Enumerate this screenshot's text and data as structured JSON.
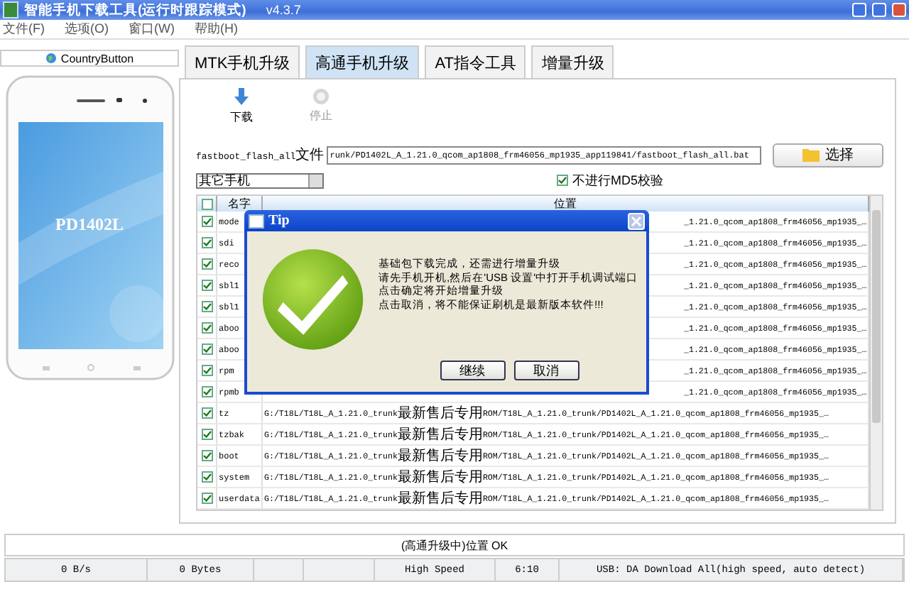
{
  "window": {
    "title": "智能手机下载工具(运行时跟踪模式)",
    "version": "v4.3.7"
  },
  "menu": [
    "文件(F)",
    "选项(O)",
    "窗口(W)",
    "帮助(H)"
  ],
  "sidebar": {
    "country_button": "CountryButton",
    "phone_label": "PD1402L"
  },
  "tabs": [
    {
      "label": "MTK手机升级",
      "selected": false
    },
    {
      "label": "高通手机升级",
      "selected": true
    },
    {
      "label": "AT指令工具",
      "selected": false
    },
    {
      "label": "增量升级",
      "selected": false
    }
  ],
  "toolbar": [
    {
      "label": "下载",
      "disabled": false
    },
    {
      "label": "停止",
      "disabled": true
    }
  ],
  "file_row": {
    "label": "fastboot_flash_all文件",
    "value": "runk/PD1402L_A_1.21.0_qcom_ap1808_frm46056_mp1935_app119841/fastboot_flash_all.bat",
    "button": "选择"
  },
  "phone_select": {
    "value": "其它手机"
  },
  "md5_option": {
    "label": "不进行MD5校验",
    "checked": true
  },
  "table": {
    "select_all": false,
    "columns": [
      "名字",
      "位置"
    ],
    "rows": [
      {
        "kind": "partial",
        "checked": true,
        "name": "mode",
        "path": "_1.21.0_qcom_ap1808_frm46056_mp1935_…"
      },
      {
        "kind": "partial",
        "checked": true,
        "name": "sdi",
        "path": "_1.21.0_qcom_ap1808_frm46056_mp1935_…"
      },
      {
        "kind": "partial",
        "checked": true,
        "name": "reco",
        "path": "_1.21.0_qcom_ap1808_frm46056_mp1935_…"
      },
      {
        "kind": "partial",
        "checked": true,
        "name": "sbl1",
        "path": "_1.21.0_qcom_ap1808_frm46056_mp1935_…"
      },
      {
        "kind": "partial",
        "checked": true,
        "name": "sbl1",
        "path": "_1.21.0_qcom_ap1808_frm46056_mp1935_…"
      },
      {
        "kind": "partial",
        "checked": true,
        "name": "aboo",
        "path": "_1.21.0_qcom_ap1808_frm46056_mp1935_…"
      },
      {
        "kind": "partial",
        "checked": true,
        "name": "aboo",
        "path": "_1.21.0_qcom_ap1808_frm46056_mp1935_…"
      },
      {
        "kind": "partial",
        "checked": true,
        "name": "rpm",
        "path": "_1.21.0_qcom_ap1808_frm46056_mp1935_…"
      },
      {
        "kind": "partial",
        "checked": true,
        "name": "rpmb",
        "path": "_1.21.0_qcom_ap1808_frm46056_mp1935_…"
      },
      {
        "kind": "full",
        "checked": true,
        "name": "tz",
        "path": "G:/T18L/T18L_A_1.21.0_trunk最新售后专用ROM/T18L_A_1.21.0_trunk/PD1402L_A_1.21.0_qcom_ap1808_frm46056_mp1935_…"
      },
      {
        "kind": "full",
        "checked": true,
        "name": "tzbak",
        "path": "G:/T18L/T18L_A_1.21.0_trunk最新售后专用ROM/T18L_A_1.21.0_trunk/PD1402L_A_1.21.0_qcom_ap1808_frm46056_mp1935_…"
      },
      {
        "kind": "full",
        "checked": true,
        "name": "boot",
        "path": "G:/T18L/T18L_A_1.21.0_trunk最新售后专用ROM/T18L_A_1.21.0_trunk/PD1402L_A_1.21.0_qcom_ap1808_frm46056_mp1935_…"
      },
      {
        "kind": "full",
        "checked": true,
        "name": "system",
        "path": "G:/T18L/T18L_A_1.21.0_trunk最新售后专用ROM/T18L_A_1.21.0_trunk/PD1402L_A_1.21.0_qcom_ap1808_frm46056_mp1935_…"
      },
      {
        "kind": "full",
        "checked": true,
        "name": "userdata",
        "path": "G:/T18L/T18L_A_1.21.0_trunk最新售后专用ROM/T18L_A_1.21.0_trunk/PD1402L_A_1.21.0_qcom_ap1808_frm46056_mp1935_…"
      }
    ]
  },
  "dialog": {
    "title": "Tip",
    "message": [
      "基础包下载完成，还需进行增量升级",
      "请先手机开机,然后在'USB 设置'中打开手机调试端口",
      "点击确定将开始增量升级",
      "点击取消，将不能保证刷机是最新版本软件!!!"
    ],
    "buttons": [
      "继续",
      "取消"
    ]
  },
  "status_line": "(高通升级中)位置 OK",
  "status_bar": [
    "0 B/s",
    "0 Bytes",
    "High Speed",
    "6:10",
    "USB: DA Download All(high speed, auto detect)"
  ]
}
